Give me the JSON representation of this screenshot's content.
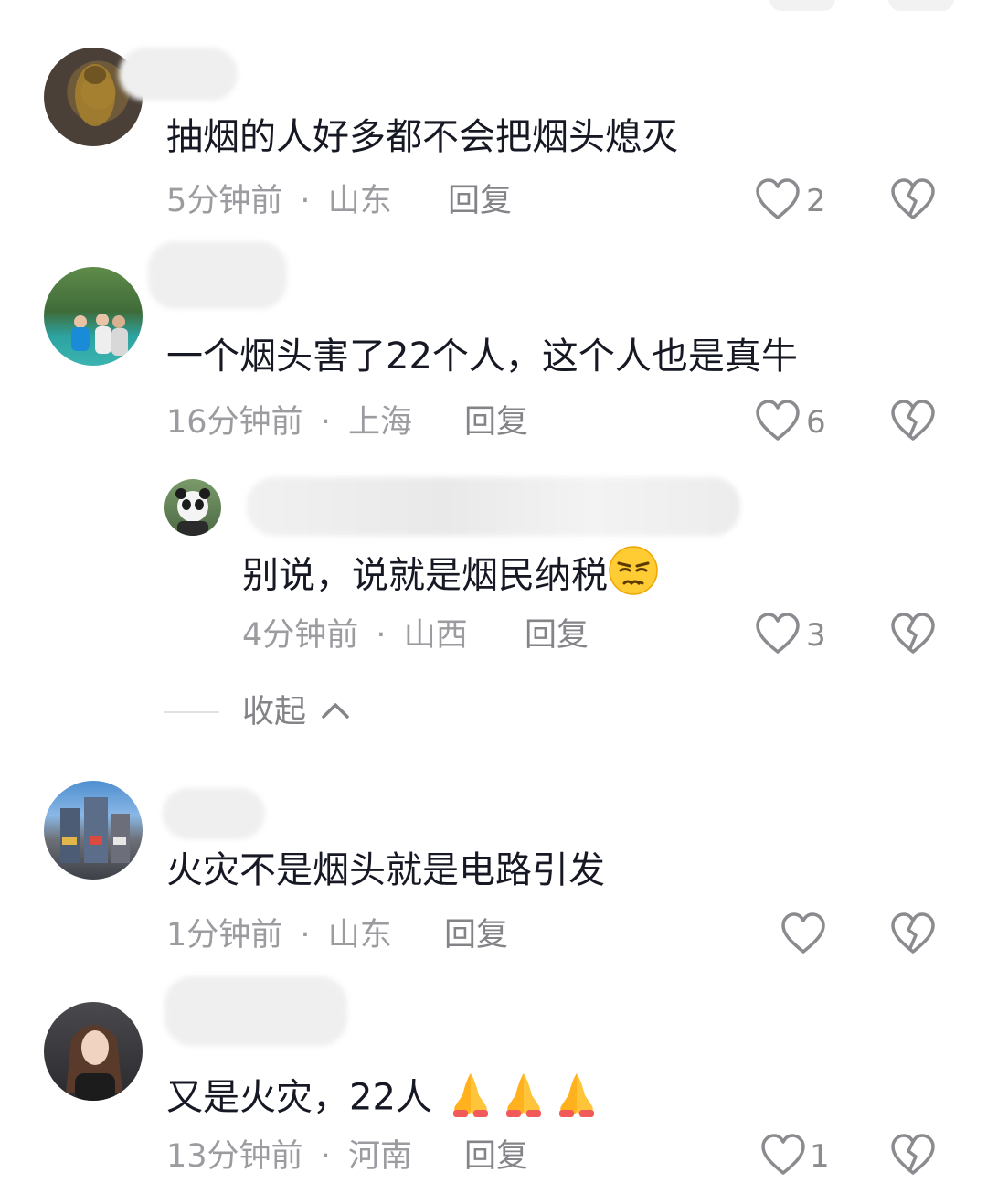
{
  "comments": [
    {
      "text": "抽烟的人好多都不会把烟头熄灭",
      "time": "5分钟前",
      "dot": "·",
      "location": "山东",
      "reply_label": "回复",
      "likes": "2"
    },
    {
      "text": "一个烟头害了22个人，这个人也是真牛",
      "time": "16分钟前",
      "dot": "·",
      "location": "上海",
      "reply_label": "回复",
      "likes": "6",
      "replies": [
        {
          "text": "别说，说就是烟民纳税",
          "emoji": "unamused-face-emoji",
          "time": "4分钟前",
          "dot": "·",
          "location": "山西",
          "reply_label": "回复",
          "likes": "3"
        }
      ],
      "collapse_label": "收起"
    },
    {
      "text": "火灾不是烟头就是电路引发",
      "time": "1分钟前",
      "dot": "·",
      "location": "山东",
      "reply_label": "回复",
      "likes": ""
    },
    {
      "text": "又是火灾，22人",
      "emoji": "folded-hands-emoji",
      "emoji_count": 3,
      "time": "13分钟前",
      "dot": "·",
      "location": "河南",
      "reply_label": "回复",
      "likes": "1"
    }
  ],
  "colors": {
    "text": "#161823",
    "meta": "#9b9ba0",
    "icon": "#8a8a8f"
  }
}
